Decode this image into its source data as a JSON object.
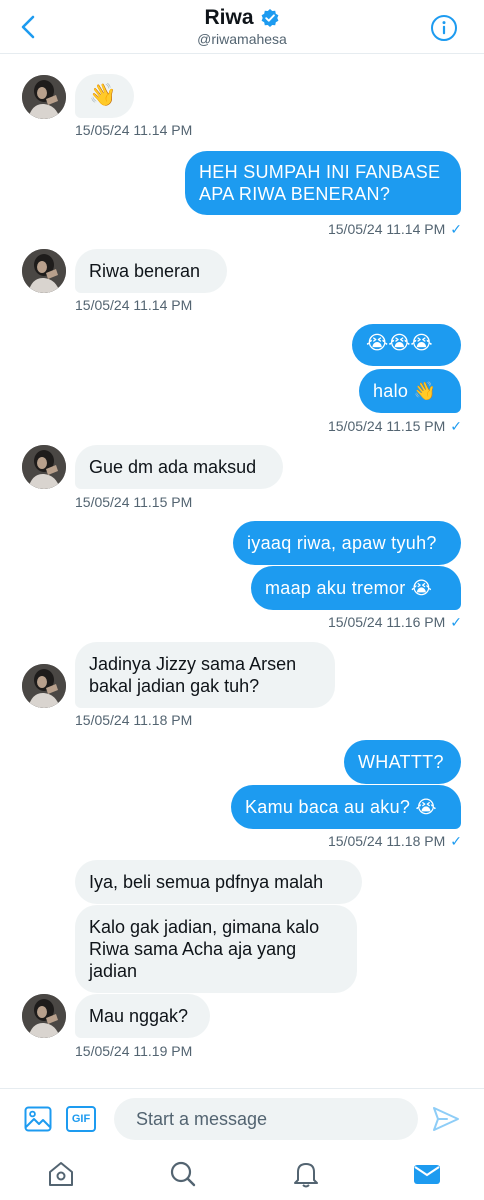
{
  "header": {
    "title": "Riwa",
    "handle": "@riwamahesa"
  },
  "messages": {
    "m1": "👋",
    "t1": "15/05/24 11.14 PM",
    "m2_line1": "HEH SUMPAH INI FANBASE",
    "m2_line2": "APA RIWA BENERAN?",
    "t2": "15/05/24 11.14 PM",
    "m3": "Riwa beneran",
    "t3": "15/05/24 11.14 PM",
    "m4": "😭😭😭",
    "m5": "halo 👋",
    "t5": "15/05/24 11.15 PM",
    "m6": "Gue dm ada maksud",
    "t6": "15/05/24 11.15 PM",
    "m7": "iyaaq riwa, apaw tyuh?",
    "m8": "maap aku tremor 😭",
    "t8": "15/05/24 11.16 PM",
    "m9_line1": "Jadinya Jizzy sama Arsen",
    "m9_line2": "bakal jadian gak tuh?",
    "t9": "15/05/24 11.18 PM",
    "m10": "WHATTT?",
    "m11": "Kamu baca au aku? 😭",
    "t11": "15/05/24 11.18 PM",
    "m12": "Iya, beli semua pdfnya malah",
    "m13_line1": "Kalo gak jadian, gimana kalo",
    "m13_line2": "Riwa sama Acha aja yang",
    "m13_line3": "jadian",
    "m14": "Mau nggak?",
    "t14": "15/05/24 11.19 PM"
  },
  "composer": {
    "gif_label": "GIF",
    "placeholder": "Start a message"
  },
  "colors": {
    "accent": "#1d9bf0",
    "incoming_bubble": "#eff3f4",
    "muted_text": "#536471"
  },
  "icons": {
    "back": "chevron-left-icon",
    "verified": "verified-badge-icon",
    "info": "info-icon",
    "image": "image-icon",
    "send": "send-icon",
    "home": "home-icon",
    "search": "search-icon",
    "notifications": "bell-icon",
    "messages": "mail-icon"
  }
}
